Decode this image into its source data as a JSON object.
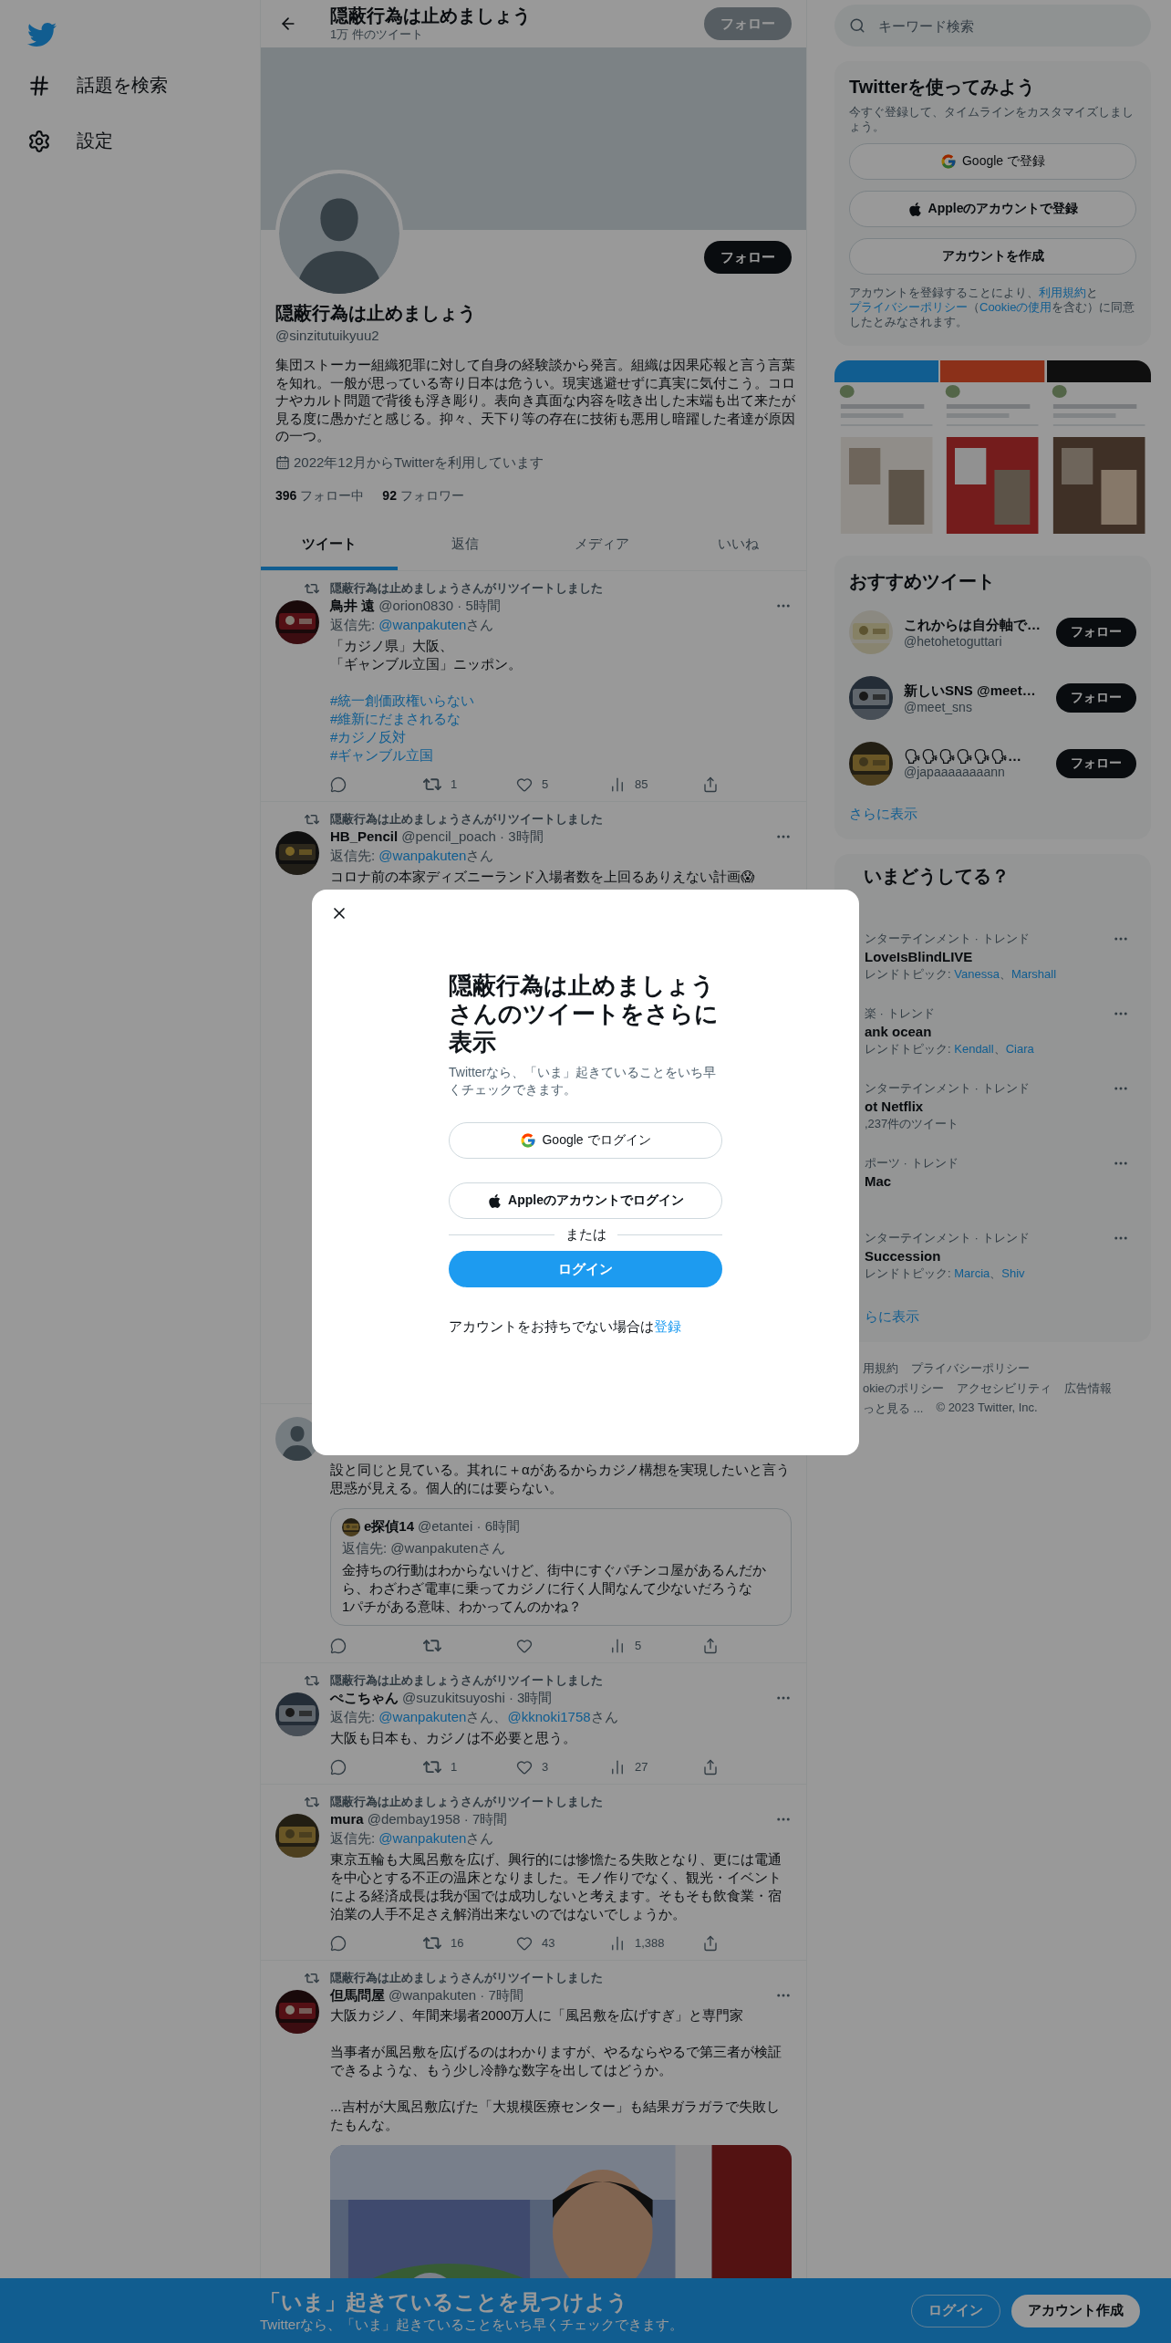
{
  "nav": {
    "items": [
      {
        "kind": "hash",
        "label": "話題を検索"
      },
      {
        "kind": "gear",
        "label": "設定"
      }
    ]
  },
  "header": {
    "title": "隠蔽行為は止めましょう",
    "subtitle": "1万 件のツイート",
    "follow_button": "フォロー"
  },
  "profile": {
    "follow_button": "フォロー",
    "name": "隠蔽行為は止めましょう",
    "handle": "@sinzitutuikyuu2",
    "bio": "集団ストーカー組織犯罪に対して自身の経験談から発言。組織は因果応報と言う言葉を知れ。一般が思っている寄り日本は危うい。現実逃避せずに真実に気付こう。コロナやカルト問題で背後も浮き彫り。表向き真面な内容を呟き出した末端も出て来たが見る度に愚かだと感じる。抑々、天下り等の存在に技術も悪用し暗躍した者達が原因の一つ。",
    "joined": "2022年12月からTwitterを利用しています",
    "following_count": "396",
    "following_label": "フォロー中",
    "followers_count": "92",
    "followers_label": "フォロワー"
  },
  "tabs": [
    {
      "label": "ツイート",
      "selected": true
    },
    {
      "label": "返信",
      "selected": false
    },
    {
      "label": "メディア",
      "selected": false
    },
    {
      "label": "いいね",
      "selected": false
    }
  ],
  "tweets": [
    {
      "retweeted_by": "隠蔽行為は止めましょうさんがリツイートしました",
      "avatar": {
        "kind": "picture"
      },
      "name": "鳥井 遠",
      "meta": "@orion0830 · 5時間",
      "reply_prefix": "返信先:",
      "mentions": [
        {
          "handle": "@wanpakuten",
          "suffix": "さん"
        }
      ],
      "paragraphs": [
        [
          "「カジノ県」大阪、",
          "「ギャンブル立国」ニッポン。"
        ]
      ],
      "hashtags": [
        "#統一創価政権いらない",
        "#維新にだまされるな",
        "#カジノ反対",
        "#ギャンブル立国"
      ],
      "actions": [
        {
          "kind": "reply"
        },
        {
          "kind": "retweet",
          "count": "1"
        },
        {
          "kind": "like",
          "count": "5"
        },
        {
          "kind": "views",
          "count": "85"
        },
        {
          "kind": "share"
        }
      ]
    },
    {
      "retweeted_by": "隠蔽行為は止めましょうさんがリツイートしました",
      "avatar": {
        "kind": "picture"
      },
      "name": "HB_Pencil",
      "meta": "@pencil_poach · 3時間",
      "reply_prefix": "返信先:",
      "mentions": [
        {
          "handle": "@wanpakuten",
          "suffix": "さん"
        }
      ],
      "paragraphs": [
        [
          "コロナ前の本家ディズニーランド入場者数を上回るありえない計画😱"
        ]
      ]
    },
    {
      "avatar": {
        "kind": "default"
      },
      "paragraphs": [
        [
          "設と同じと見ている。其れに＋αがあるからカジノ構想を実現したいと言う思惑が見える。個人的には要らない。"
        ]
      ],
      "quote": {
        "name": "e探偵14",
        "meta": "@etantei · 6時間",
        "reply": "返信先: @wanpakutenさん",
        "lines": [
          "金持ちの行動はわからないけど、街中にすぐパチンコ屋があるんだから、わざわざ電車に乗ってカジノに行く人間なんて少ないだろうな",
          "1パチがある意味、わかってんのかね？"
        ]
      },
      "actions": [
        {
          "kind": "reply"
        },
        {
          "kind": "retweet"
        },
        {
          "kind": "like"
        },
        {
          "kind": "views",
          "count": "5"
        },
        {
          "kind": "share"
        }
      ]
    },
    {
      "retweeted_by": "隠蔽行為は止めましょうさんがリツイートしました",
      "avatar": {
        "kind": "picture"
      },
      "name": "ぺこちゃん",
      "meta": "@suzukitsuyoshi · 3時間",
      "reply_prefix": "返信先:",
      "mentions": [
        {
          "handle": "@wanpakuten",
          "suffix": "さん、"
        },
        {
          "handle": "@kknoki1758",
          "suffix": "さん"
        }
      ],
      "paragraphs": [
        [
          "大阪も日本も、カジノは不必要と思う。"
        ]
      ],
      "actions": [
        {
          "kind": "reply"
        },
        {
          "kind": "retweet",
          "count": "1"
        },
        {
          "kind": "like",
          "count": "3"
        },
        {
          "kind": "views",
          "count": "27"
        },
        {
          "kind": "share"
        }
      ]
    },
    {
      "retweeted_by": "隠蔽行為は止めましょうさんがリツイートしました",
      "avatar": {
        "kind": "picture"
      },
      "name": "mura",
      "meta": "@dembay1958 · 7時間",
      "reply_prefix": "返信先:",
      "mentions": [
        {
          "handle": "@wanpakuten",
          "suffix": "さん"
        }
      ],
      "paragraphs": [
        [
          "東京五輪も大風呂敷を広げ、興行的には惨憺たる失敗となり、更には電通を中心とする不正の温床となりました。モノ作りでなく、観光・イベントによる経済成長は我が国では成功しないと考えます。そもそも飲食業・宿泊業の人手不足さえ解消出来ないのではないでしょうか。"
        ]
      ],
      "actions": [
        {
          "kind": "reply"
        },
        {
          "kind": "retweet",
          "count": "16"
        },
        {
          "kind": "like",
          "count": "43"
        },
        {
          "kind": "views",
          "count": "1,388"
        },
        {
          "kind": "share"
        }
      ]
    },
    {
      "retweeted_by": "隠蔽行為は止めましょうさんがリツイートしました",
      "avatar": {
        "kind": "picture"
      },
      "name": "但馬問屋",
      "meta": "@wanpakuten · 7時間",
      "paragraphs": [
        [
          "大阪カジノ、年間来場者2000万人に「風呂敷を広げすぎ」と専門家"
        ],
        [
          "当事者が風呂敷を広げるのはわかりますが、やるならやるで第三者が検証できるような、もう少し冷静な数字を出してはどうか。"
        ],
        [
          "...吉村が大風呂敷広げた「大規模医療センター」も結果ガラガラで失敗したもんな。"
        ]
      ],
      "media": {
        "kind": "picture"
      }
    }
  ],
  "search": {
    "placeholder": "キーワード検索"
  },
  "signup_card": {
    "title": "Twitterを使ってみよう",
    "subtitle": "今すぐ登録して、タイムラインをカスタマイズしましょう。",
    "buttons": [
      {
        "kind": "google",
        "label": "Google で登録"
      },
      {
        "kind": "apple",
        "label": "Appleのアカウントで登録"
      },
      {
        "kind": "plain",
        "label": "アカウントを作成"
      }
    ],
    "legal": [
      {
        "text": "アカウントを登録することにより、"
      },
      {
        "text": "利用規約",
        "link": true
      },
      {
        "text": "と"
      },
      {
        "text": "プライバシーポリシー",
        "link": true
      },
      {
        "text": "（"
      },
      {
        "text": "Cookieの使用",
        "link": true
      },
      {
        "text": "を含む）に同意したとみなされます。"
      }
    ]
  },
  "media_grid": [
    {
      "kind": "picture"
    },
    {
      "kind": "picture"
    },
    {
      "kind": "picture"
    }
  ],
  "recommended": {
    "title": "おすすめツイート",
    "accounts": [
      {
        "name": "これからは自分軸で…",
        "handle": "@hetohetoguttari",
        "button": "フォロー"
      },
      {
        "name": "新しいSNS @meet…",
        "handle": "@meet_sns",
        "button": "フォロー"
      },
      {
        "name": "🗣🗣🗣🗣🗣🗣…",
        "handle": "@japaaaaaaaann",
        "button": "フォロー"
      }
    ],
    "more": "さらに表示"
  },
  "trends": {
    "title": "いまどうしてる？",
    "items": [
      {
        "category": "ンターテインメント · トレンド",
        "name": "LoveIsBlindLIVE",
        "topics_prefix": "レンドトピック:",
        "topics": [
          "Vanessa",
          "Marshall"
        ],
        "separator": "、"
      },
      {
        "category": "楽 · トレンド",
        "name": "ank ocean",
        "topics_prefix": "レンドトピック:",
        "topics": [
          "Kendall",
          "Ciara"
        ],
        "separator": "、"
      },
      {
        "category": "ンターテインメント · トレンド",
        "name": "ot Netflix",
        "count": ",237件のツイート"
      },
      {
        "category": "ポーツ · トレンド",
        "name": "Mac"
      },
      {
        "category": "ンターテインメント · トレンド",
        "name": "Succession",
        "topics_prefix": "レンドトピック:",
        "topics": [
          "Marcia",
          "Shiv"
        ],
        "separator": "、"
      }
    ],
    "more": "らに表示"
  },
  "footer": [
    "用規約",
    "プライバシーポリシー",
    "okieのポリシー",
    "アクセシビリティ",
    "広告情報",
    "っと見る ...",
    "© 2023 Twitter, Inc."
  ],
  "modal": {
    "title": "隠蔽行為は止めましょうさんのツイートをさらに表示",
    "subtitle": "Twitterなら、「いま」起きていることをいち早くチェックできます。",
    "buttons": [
      {
        "kind": "google",
        "label": "Google でログイン"
      },
      {
        "kind": "apple",
        "label": "Appleのアカウントでログイン"
      }
    ],
    "divider": "または",
    "login": "ログイン",
    "signup_prompt": "アカウントをお持ちでない場合は",
    "signup_link": "登録"
  },
  "bottom_bar": {
    "title": "「いま」起きていることを見つけよう",
    "subtitle": "Twitterなら、「いま」起きていることをいち早くチェックできます。",
    "login": "ログイン",
    "signup": "アカウント作成"
  }
}
